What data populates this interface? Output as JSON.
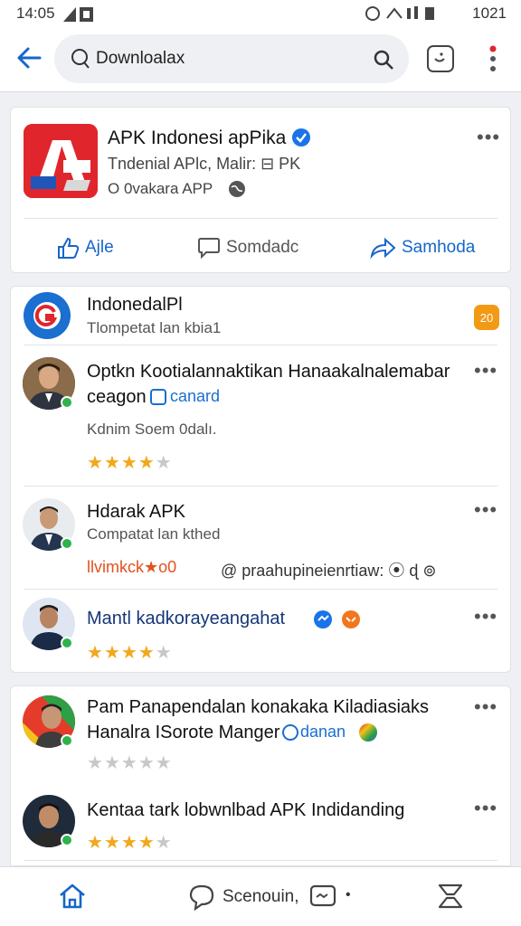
{
  "status_bar": {
    "time": "14:05",
    "right": "1021"
  },
  "search": {
    "value": "Downloalax"
  },
  "page_card": {
    "name": "APK Indonesi apPika",
    "subtitle": "Tndenial APlc, Malir: ⊟ PK",
    "meta": "O 0vakara APP",
    "actions": [
      {
        "label": "Ajle"
      },
      {
        "label": "Somdadc"
      },
      {
        "label": "Samhoda"
      }
    ]
  },
  "feed": {
    "header": {
      "title": "IndonedalPl",
      "subtitle": "Tlompetat lan kbia1",
      "badge": "20"
    },
    "items": [
      {
        "title_line1": "Optkn Kootialannaktikan Hanaakalnalemabar",
        "title_line2": "ceagon",
        "chip": "canard",
        "detail": "Kdnim Soem 0dalı.",
        "rating": 4
      },
      {
        "title": "Hdarak APK",
        "subtitle": "Compatat lan kthed",
        "orange": "llvimkck★o0",
        "icons_text": "@ praahupineienrtiaw: ⦿ ɖ ⊚"
      },
      {
        "title": "Mantl kadkorayeangahat",
        "rating": 4
      }
    ]
  },
  "feed2": {
    "items": [
      {
        "title_line1": "Pam Panapendalan konakaka Kiladiasiaks",
        "title_line2": "Hanalra ISorote Manger",
        "chip": "danan",
        "rating": 0
      },
      {
        "title": "Kentaa tark lobwnlbad APK Indidanding",
        "rating": 4
      }
    ]
  },
  "bottom_nav": {
    "label": "Scenouin,"
  },
  "colors": {
    "accent": "#1666c9",
    "star": "#f2a81d",
    "logo": "#e02a2a",
    "online": "#2fb24c"
  }
}
